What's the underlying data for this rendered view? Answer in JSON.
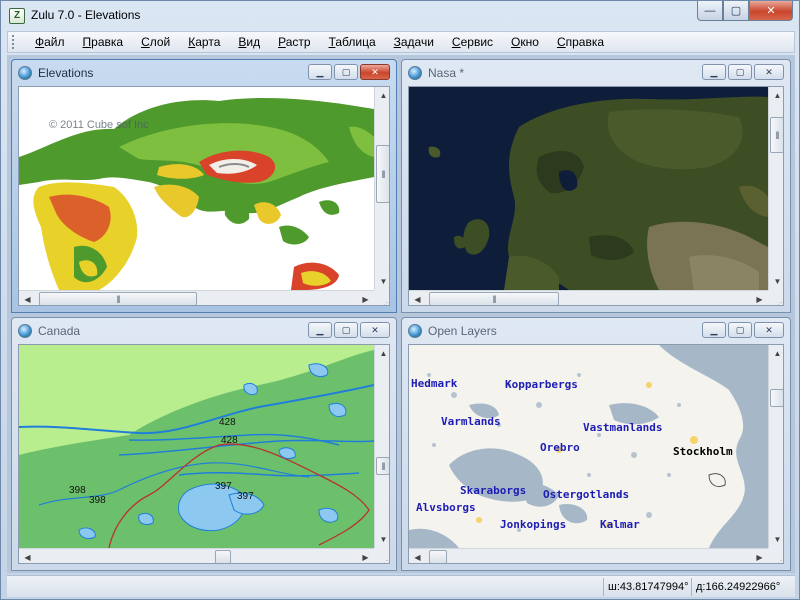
{
  "app": {
    "title": "Zulu 7.0 - Elevations",
    "icon_text": "Z",
    "controls": {
      "minimize": "—",
      "maximize": "▢",
      "close": "✕"
    }
  },
  "menu": [
    {
      "label": "Файл",
      "hotkey": "Ф",
      "rest": "айл"
    },
    {
      "label": "Правка",
      "hotkey": "П",
      "rest": "равка"
    },
    {
      "label": "Слой",
      "hotkey": "С",
      "rest": "лой"
    },
    {
      "label": "Карта",
      "hotkey": "К",
      "rest": "арта"
    },
    {
      "label": "Вид",
      "hotkey": "В",
      "rest": "ид"
    },
    {
      "label": "Растр",
      "hotkey": "Р",
      "rest": "астр"
    },
    {
      "label": "Таблица",
      "hotkey": "Т",
      "rest": "аблица"
    },
    {
      "label": "Задачи",
      "hotkey": "З",
      "rest": "адачи"
    },
    {
      "label": "Сервис",
      "hotkey": "С",
      "rest": "ервис"
    },
    {
      "label": "Окно",
      "hotkey": "О",
      "rest": "кно"
    },
    {
      "label": "Справка",
      "hotkey": "С",
      "rest": "правка"
    }
  ],
  "windows": {
    "elevations": {
      "title": "Elevations",
      "copyright": "© 2011 Cube sof Inc"
    },
    "nasa": {
      "title": "Nasa *"
    },
    "canada": {
      "title": "Canada",
      "labels": [
        "428",
        "428",
        "398",
        "398",
        "397",
        "397"
      ]
    },
    "openlayers": {
      "title": "Open Layers",
      "labels": [
        "Hedmark",
        "Kopparbergs",
        "Varmlands",
        "Vastmanlands",
        "Orebro",
        "Stockholm",
        "Skaraborgs",
        "Ostergotlands",
        "Alvsborgs",
        "Jonkopings",
        "Kalmar"
      ]
    }
  },
  "window_controls": {
    "minimize": "▁",
    "maximize": "▢",
    "close": "✕"
  },
  "scroll": {
    "up": "▲",
    "down": "▼",
    "left": "◀",
    "right": "▶",
    "grip": "|||",
    "sizegrip": "⋰"
  },
  "status": {
    "latitude": "ш:43.81747994°",
    "longitude": "д:166.24922966°"
  },
  "colors": {
    "label_blue": "#1d1db5",
    "canada_land": "#6cc06c",
    "canada_water": "#8cc8f0"
  }
}
